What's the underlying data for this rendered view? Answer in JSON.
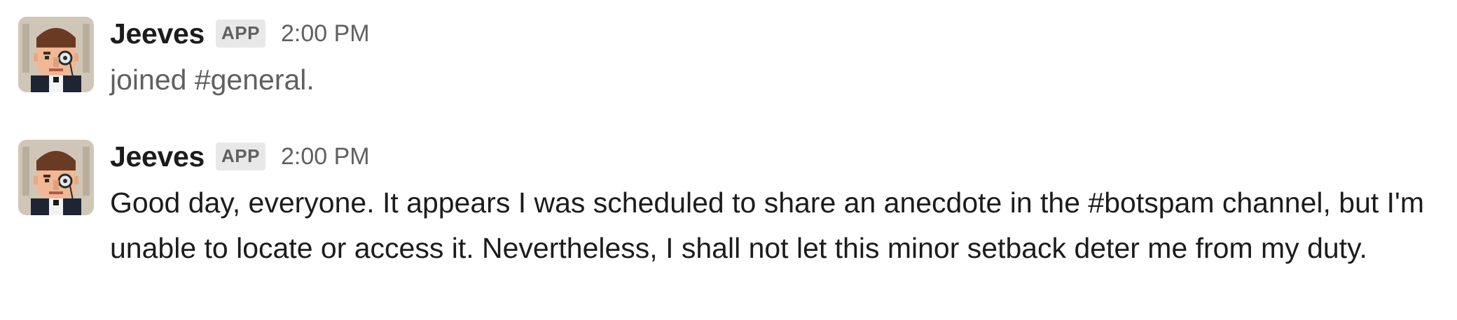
{
  "messages": [
    {
      "author": "Jeeves",
      "badge": "APP",
      "time": "2:00 PM",
      "text": "joined #general.",
      "avatar_icon": "butler-monocle-avatar"
    },
    {
      "author": "Jeeves",
      "badge": "APP",
      "time": "2:00 PM",
      "text": "Good day, everyone. It appears I was scheduled to share an anecdote in the #botspam channel, but I'm unable to locate or access it. Nevertheless, I shall not let this minor setback deter me from my duty.",
      "avatar_icon": "butler-monocle-avatar"
    }
  ],
  "colors": {
    "text": "#1d1c1d",
    "muted": "#616061",
    "badge_bg": "#e8e8e8",
    "background": "#ffffff"
  }
}
